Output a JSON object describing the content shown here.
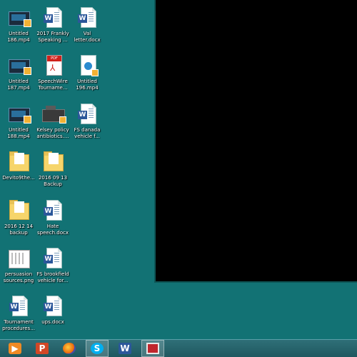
{
  "desktop": {
    "icons": [
      {
        "label": "Untitled\n186.mp4",
        "icon": "video-file-icon"
      },
      {
        "label": "2017 Frankly\nSpeaking ...",
        "icon": "word-document-icon"
      },
      {
        "label": "Val\nletter.docx",
        "icon": "word-document-icon"
      },
      {
        "label": "Untitled\n187.mp4",
        "icon": "video-file-icon"
      },
      {
        "label": "SpeechWire\nTourname...",
        "icon": "pdf-file-icon"
      },
      {
        "label": "Untitled\n196.mp4",
        "icon": "audio-file-icon"
      },
      {
        "label": "Untitled\n188.mp4",
        "icon": "video-file-icon"
      },
      {
        "label": "Kelsey policy\nantibiotics....",
        "icon": "presentation-file-icon"
      },
      {
        "label": "FS danada\nvehicle f...",
        "icon": "word-document-icon"
      },
      {
        "label": "Devito9the...",
        "icon": "folder-icon"
      },
      {
        "label": "2016 09 13\nBackup",
        "icon": "folder-icon"
      },
      {
        "label": "2016 12 14\nbackup",
        "icon": "folder-icon"
      },
      {
        "label": "Hate\nspeech.docx",
        "icon": "word-document-icon"
      },
      {
        "label": "persuasion\nsources.png",
        "icon": "image-file-icon"
      },
      {
        "label": "FS brookfield\nvehicle for...",
        "icon": "word-document-icon"
      },
      {
        "label": "Tournament\nprocedures...",
        "icon": "word-document-icon"
      },
      {
        "label": "ups.docx",
        "icon": "word-document-icon"
      }
    ]
  },
  "window": {
    "content": ""
  },
  "taskbar": {
    "items": [
      {
        "name": "media-player",
        "icon": "media-player-icon",
        "glyph": "▶"
      },
      {
        "name": "powerpoint",
        "icon": "powerpoint-icon",
        "glyph": "P"
      },
      {
        "name": "firefox",
        "icon": "firefox-icon",
        "glyph": ""
      },
      {
        "name": "skype",
        "icon": "skype-icon",
        "glyph": "S"
      },
      {
        "name": "word",
        "icon": "word-icon",
        "glyph": "W"
      },
      {
        "name": "recorder",
        "icon": "recorder-icon",
        "glyph": ""
      }
    ]
  }
}
